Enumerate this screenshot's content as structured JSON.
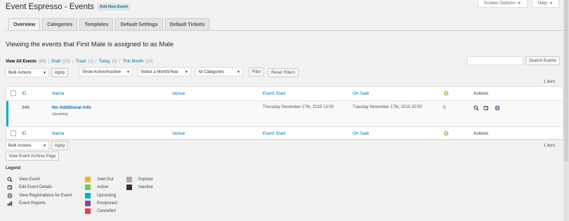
{
  "header": {
    "title": "Event Espresso - Events",
    "add_new": "Add New Event",
    "screen_options": "Screen Options",
    "help": "Help"
  },
  "tabs": [
    {
      "label": "Overview",
      "active": true
    },
    {
      "label": "Categories"
    },
    {
      "label": "Templates"
    },
    {
      "label": "Default Settings"
    },
    {
      "label": "Default Tickets"
    }
  ],
  "viewing_text": "Viewing the events that First Male is assigned to as Male",
  "search": {
    "placeholder": "",
    "button": "Search Events"
  },
  "filters": {
    "views": [
      {
        "label": "View All Events",
        "count": "(86)"
      },
      {
        "label": "Draft",
        "count": "(20)"
      },
      {
        "label": "Trash",
        "count": "(1)"
      },
      {
        "label": "Today",
        "count": "(0)"
      },
      {
        "label": "This Month",
        "count": "(10)"
      }
    ],
    "bulk_actions": "Bulk Actions",
    "apply": "Apply",
    "active_select": "Show Active/Inactive",
    "month_select": "Select a Month/Year",
    "category_select": "All Categories",
    "filter": "Filter",
    "reset": "Reset Filters"
  },
  "pagination": {
    "items": "1 item"
  },
  "table": {
    "columns": {
      "id": "ID",
      "name": "Name",
      "venue": "Venue",
      "event_start": "Event Start",
      "on_sale": "On Sale",
      "actions": "Actions"
    },
    "rows": [
      {
        "id": "346",
        "name": "No Additional Info",
        "status": "Upcoming",
        "venue": "",
        "event_start": "Thursday December 17th, 2015 13:00",
        "on_sale": "Tuesday November 17th, 2015 20:50",
        "registrations": "5"
      }
    ]
  },
  "bottom": {
    "bulk_actions": "Bulk Actions",
    "apply": "Apply",
    "archive_button": "View Event Archive Page",
    "items": "1 item"
  },
  "legend": {
    "title": "Legend",
    "icons": [
      {
        "icon": "search-icon",
        "label": "View Event"
      },
      {
        "icon": "calendar-edit-icon",
        "label": "Edit Event Details"
      },
      {
        "icon": "globe-icon",
        "label": "View Registrations for Event"
      },
      {
        "icon": "chart-icon",
        "label": "Event Reports"
      }
    ],
    "statuses": [
      {
        "label": "Sold Out",
        "color": "#f0b135"
      },
      {
        "label": "Active",
        "color": "#70cc50"
      },
      {
        "label": "Upcoming",
        "color": "#00b1ca"
      },
      {
        "label": "Postponed",
        "color": "#7b4f9d"
      },
      {
        "label": "Cancelled",
        "color": "#e33e5a"
      },
      {
        "label": "Expired",
        "color": "#bfa3a3"
      },
      {
        "label": "Inactive",
        "color": "#333333"
      }
    ]
  },
  "colors": {
    "accent": "#0073aa",
    "green_icon": "#7ac142"
  }
}
